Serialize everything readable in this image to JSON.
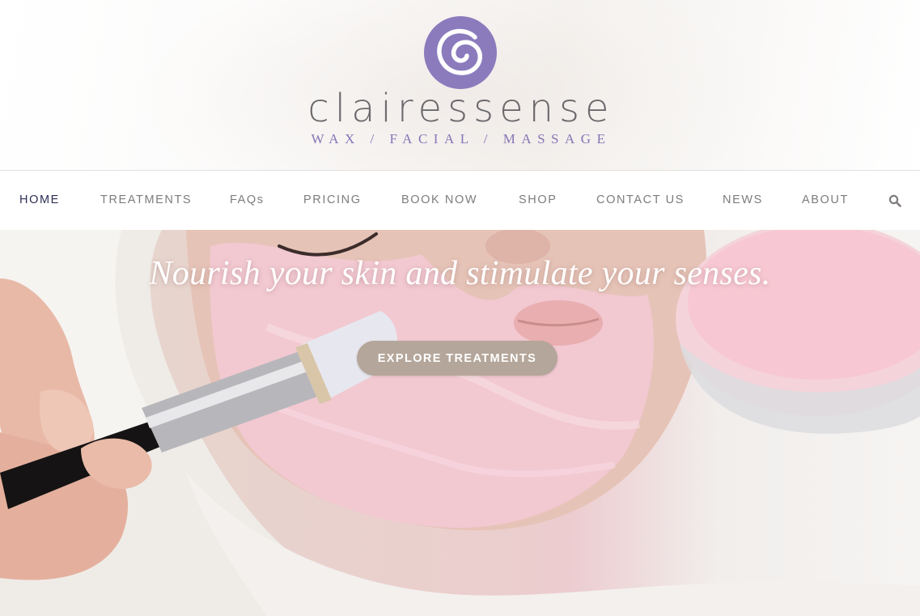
{
  "brand": {
    "name": "clairessense",
    "tagline": "WAX / FACIAL / MASSAGE",
    "logo_color": "#8b7bbd",
    "tagline_color": "#8676b6"
  },
  "nav": {
    "items": [
      {
        "label": "HOME",
        "active": true
      },
      {
        "label": "TREATMENTS",
        "active": false
      },
      {
        "label": "FAQs",
        "active": false
      },
      {
        "label": "PRICING",
        "active": false
      },
      {
        "label": "BOOK NOW",
        "active": false
      },
      {
        "label": "SHOP",
        "active": false
      },
      {
        "label": "CONTACT US",
        "active": false
      },
      {
        "label": "NEWS",
        "active": false
      },
      {
        "label": "ABOUT",
        "active": false
      }
    ],
    "search_icon": "search-icon",
    "active_color": "#2e2f55",
    "text_color": "#7f7b7e"
  },
  "hero": {
    "title": "Nourish your skin and stimulate your senses.",
    "button_label": "EXPLORE TREATMENTS",
    "button_color": "#b4a69a"
  }
}
